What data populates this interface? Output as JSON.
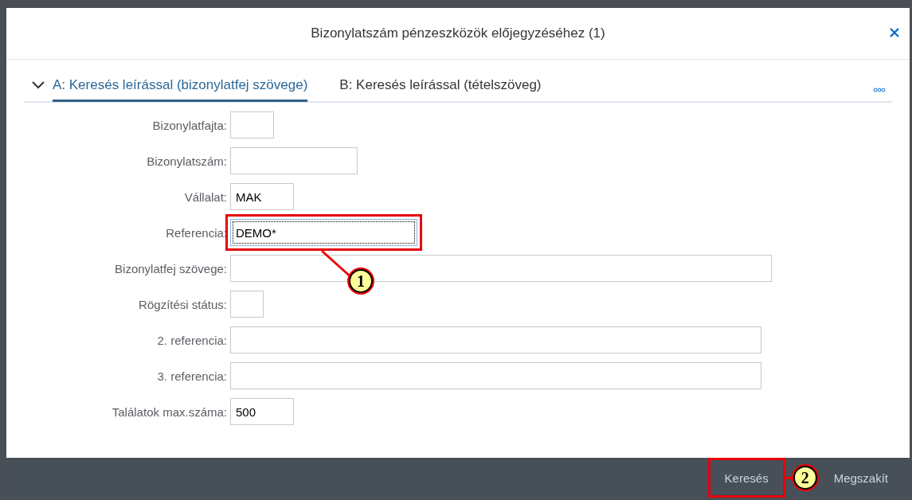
{
  "dialog": {
    "title": "Bizonylatszám pénzeszközök előjegyzéséhez (1)"
  },
  "tabs": [
    {
      "label": "A: Keresés leírással (bizonylatfej szövege)",
      "selected": true
    },
    {
      "label": "B: Keresés leírással (tételszöveg)",
      "selected": false
    }
  ],
  "fields": [
    {
      "label": "Bizonylatfajta:",
      "focused": false,
      "highlighted": false
    },
    {
      "label": "Bizonylatszám:",
      "focused": false,
      "highlighted": false
    },
    {
      "label": "Vállalat:",
      "value": "MAK",
      "focused": false,
      "highlighted": false
    },
    {
      "label": "Referencia:",
      "value": "DEMO*",
      "focused": true,
      "highlighted": true,
      "callout": "1"
    },
    {
      "label": "Bizonylatfej szövege:",
      "focused": false,
      "highlighted": false
    },
    {
      "label": "Rögzítési státus:",
      "focused": false,
      "highlighted": false
    },
    {
      "label": "2. referencia:",
      "focused": false,
      "highlighted": false
    },
    {
      "label": "3. referencia:",
      "focused": false,
      "highlighted": false
    },
    {
      "label": "Találatok max.száma:",
      "value": "500",
      "focused": false,
      "highlighted": false
    }
  ],
  "buttons": [
    {
      "label": "Keresés",
      "highlighted": true,
      "callout": "2"
    },
    {
      "label": "Megszakít",
      "highlighted": false
    }
  ]
}
